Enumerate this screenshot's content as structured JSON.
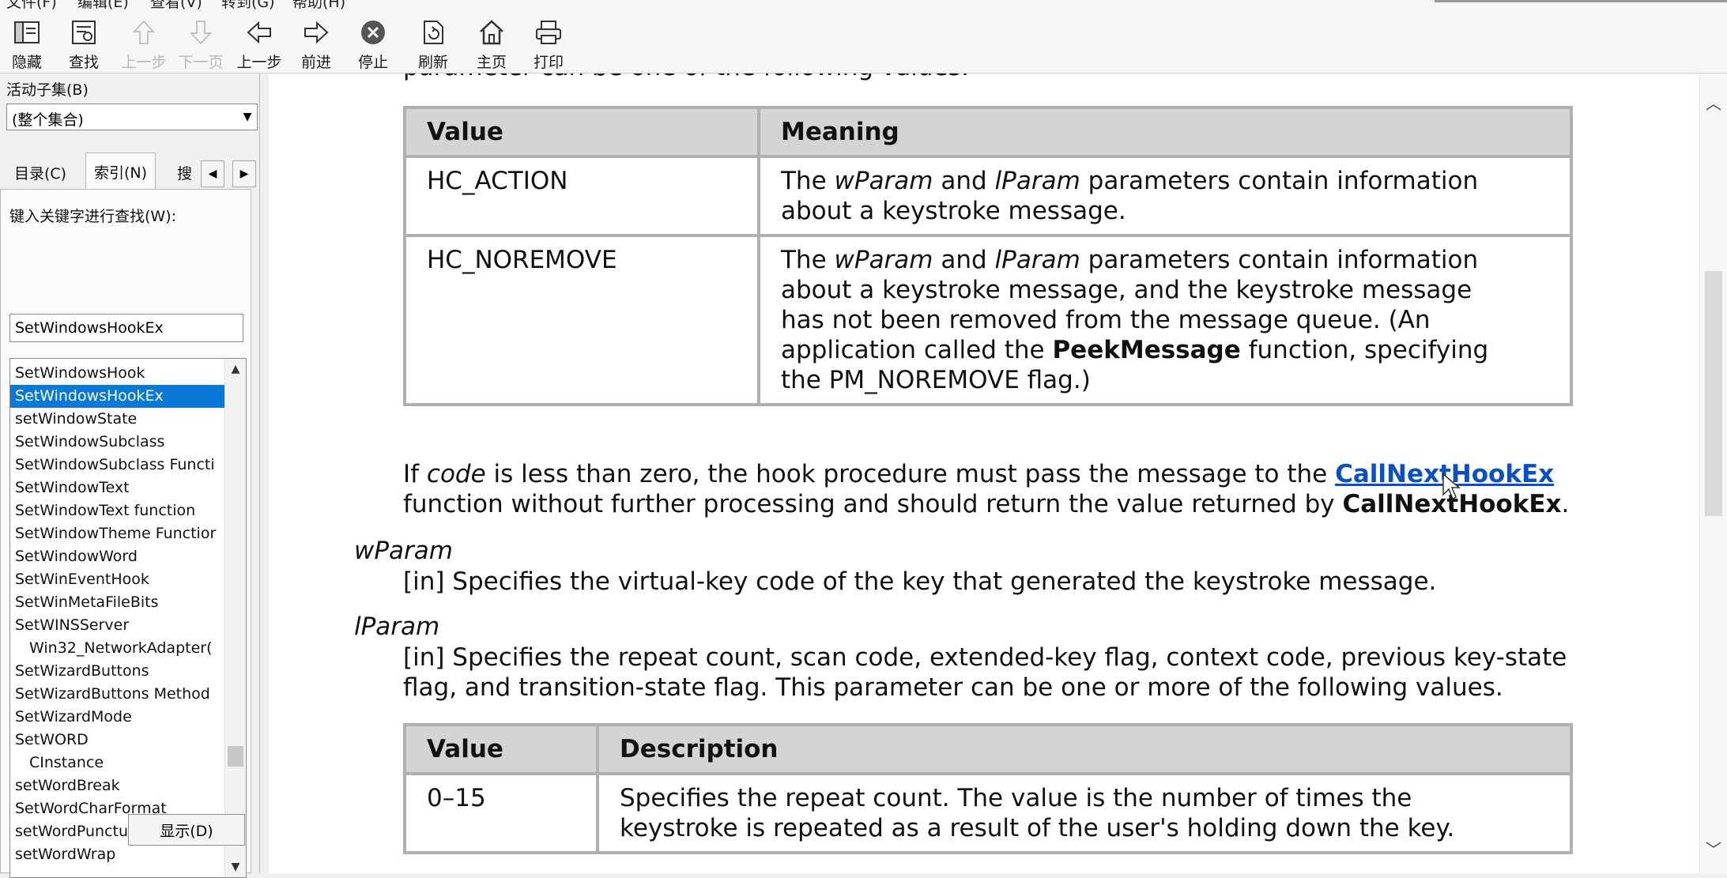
{
  "menubar": {
    "items": [
      "文件(F)",
      "编辑(E)",
      "查看(V)",
      "转到(G)",
      "帮助(H)"
    ]
  },
  "toolbar": {
    "buttons": [
      {
        "label": "隐藏",
        "icon": "hide-pane-icon",
        "enabled": true
      },
      {
        "label": "查找",
        "icon": "find-icon",
        "enabled": true
      },
      {
        "label": "上一步",
        "icon": "up-arrow-icon",
        "enabled": false
      },
      {
        "label": "下一页",
        "icon": "down-arrow-icon",
        "enabled": false
      },
      {
        "label": "上一步",
        "icon": "back-arrow-icon",
        "enabled": true
      },
      {
        "label": "前进",
        "icon": "forward-arrow-icon",
        "enabled": true
      },
      {
        "label": "停止",
        "icon": "stop-icon",
        "enabled": true
      },
      {
        "label": "刷新",
        "icon": "refresh-icon",
        "enabled": true
      },
      {
        "label": "主页",
        "icon": "home-icon",
        "enabled": true
      },
      {
        "label": "打印",
        "icon": "print-icon",
        "enabled": true
      }
    ]
  },
  "sidebar": {
    "subset_label": "活动子集(B)",
    "subset_value": "(整个集合)",
    "tabs": [
      {
        "label": "目录(C)",
        "active": false
      },
      {
        "label": "索引(N)",
        "active": true
      },
      {
        "label": "搜",
        "active": false
      }
    ],
    "keyword_label": "键入关键字进行查找(W):",
    "keyword_value": "SetWindowsHookEx",
    "index_items": [
      {
        "label": "SetWindowsHook",
        "indent": false,
        "selected": false
      },
      {
        "label": "SetWindowsHookEx",
        "indent": false,
        "selected": true
      },
      {
        "label": "setWindowState",
        "indent": false,
        "selected": false
      },
      {
        "label": "SetWindowSubclass",
        "indent": false,
        "selected": false
      },
      {
        "label": "SetWindowSubclass Functi",
        "indent": false,
        "selected": false
      },
      {
        "label": "SetWindowText",
        "indent": false,
        "selected": false
      },
      {
        "label": "SetWindowText function",
        "indent": false,
        "selected": false
      },
      {
        "label": "SetWindowTheme Functior",
        "indent": false,
        "selected": false
      },
      {
        "label": "SetWindowWord",
        "indent": false,
        "selected": false
      },
      {
        "label": "SetWinEventHook",
        "indent": false,
        "selected": false
      },
      {
        "label": "SetWinMetaFileBits",
        "indent": false,
        "selected": false
      },
      {
        "label": "SetWINSServer",
        "indent": false,
        "selected": false
      },
      {
        "label": "Win32_NetworkAdapter(",
        "indent": true,
        "selected": false
      },
      {
        "label": "SetWizardButtons",
        "indent": false,
        "selected": false
      },
      {
        "label": "SetWizardButtons Method",
        "indent": false,
        "selected": false
      },
      {
        "label": "SetWizardMode",
        "indent": false,
        "selected": false
      },
      {
        "label": "SetWORD",
        "indent": false,
        "selected": false
      },
      {
        "label": "CInstance",
        "indent": true,
        "selected": false
      },
      {
        "label": "setWordBreak",
        "indent": false,
        "selected": false
      },
      {
        "label": "SetWordCharFormat",
        "indent": false,
        "selected": false
      },
      {
        "label": "setWordPunctuation",
        "indent": false,
        "selected": false
      },
      {
        "label": "setWordWrap",
        "indent": false,
        "selected": false
      }
    ],
    "show_button": "显示(D)"
  },
  "content": {
    "cut_line": "parameter can be one of the following values:",
    "table1": {
      "headers": [
        "Value",
        "Meaning"
      ],
      "rows": [
        {
          "value": "HC_ACTION",
          "meaning_parts": [
            "The ",
            "wParam",
            " and ",
            "lParam",
            " parameters contain information",
            "about a keystroke message."
          ]
        },
        {
          "value": "HC_NOREMOVE",
          "meaning_parts": [
            "The ",
            "wParam",
            " and ",
            "lParam",
            " parameters contain information",
            "about a keystroke message, and the keystroke message",
            "has not been removed from the message queue. (An",
            "application called the ",
            "PeekMessage",
            " function, specifying",
            "the PM_NOREMOVE flag.)"
          ]
        }
      ]
    },
    "code_para": {
      "p1": "If ",
      "code": "code",
      "p2": " is less than zero, the hook procedure must pass the message to the ",
      "link": "CallNextHookEx",
      "line2": "function without further processing and should return the value returned by ",
      "bold": "CallNextHookEx",
      "end": "."
    },
    "wparam": {
      "term": "wParam",
      "desc": "[in] Specifies the virtual-key code of the key that generated the keystroke message."
    },
    "lparam": {
      "term": "lParam",
      "desc_line1": "[in] Specifies the repeat count, scan code, extended-key flag, context code, previous key-state",
      "desc_line2": "flag, and transition-state flag. This parameter can be one or more of the following values."
    },
    "table2": {
      "headers": [
        "Value",
        "Description"
      ],
      "rows": [
        {
          "value": "0–15",
          "desc_line1": "Specifies the repeat count. The value is the number of times the",
          "desc_line2": "keystroke is repeated as a result of the user's holding down the key."
        }
      ]
    }
  }
}
